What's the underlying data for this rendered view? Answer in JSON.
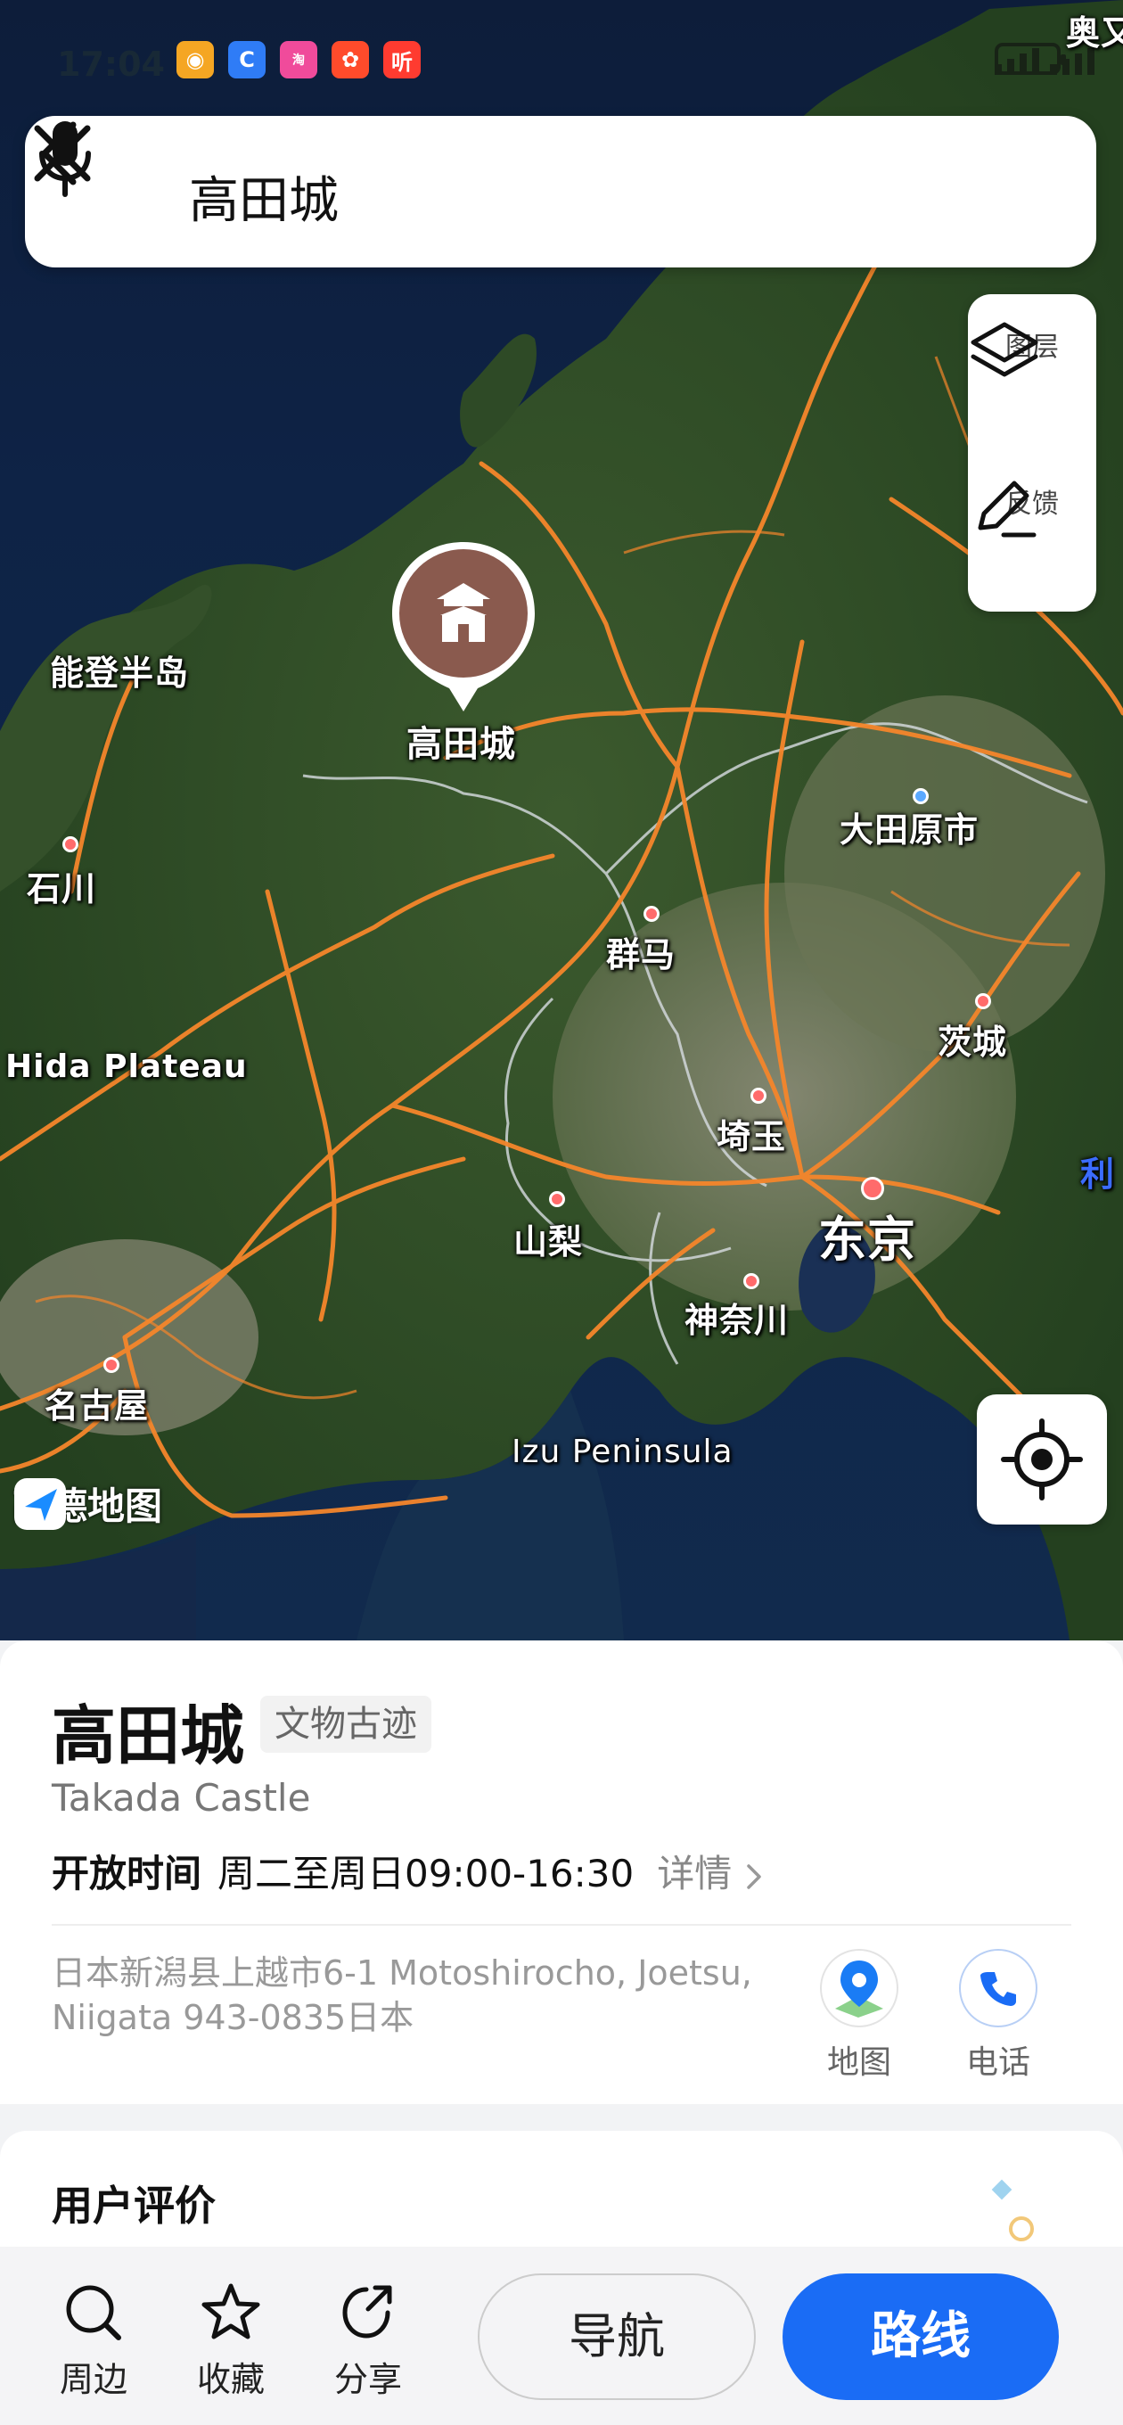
{
  "status_bar": {
    "time": "17:04",
    "apps": [
      {
        "icon": "weibo-icon",
        "text": "",
        "color": "#f5a623"
      },
      {
        "icon": "browser-360-icon",
        "text": "",
        "color": "#2f7cf6"
      },
      {
        "icon": "taobao-promo-icon",
        "text": "",
        "color": "#f04b9b"
      },
      {
        "icon": "pinduoduo-icon",
        "text": "",
        "color": "#ff4b2b"
      },
      {
        "icon": "ting-icon",
        "text": "听",
        "color": "#ff3b30"
      }
    ]
  },
  "search": {
    "query": "高田城"
  },
  "map_tools": {
    "layers_label": "图层",
    "feedback_label": "反馈"
  },
  "map": {
    "brand": "高德地图",
    "poi_label": "高田城",
    "labels": {
      "noto": "能登半岛",
      "ishikawa": "石川",
      "hida": "Hida Plateau",
      "nagoya": "名古屋",
      "gunma": "群马",
      "otawara": "大田原市",
      "ibaraki": "茨城",
      "saitama": "埼玉",
      "yamanashi": "山梨",
      "tokyo": "东京",
      "kanagawa": "神奈川",
      "izu": "Izu Peninsula",
      "edge_top": "奥又",
      "edge_right": "利"
    }
  },
  "poi": {
    "name": "高田城",
    "category": "文物古迹",
    "english_name": "Takada Castle",
    "hours_label": "开放时间",
    "hours": "周二至周日09:00-16:30",
    "details_label": "详情",
    "address": "日本新潟县上越市6-1 Motoshirocho, Joetsu, Niigata 943-0835日本",
    "map_button": "地图",
    "phone_button": "电话"
  },
  "reviews": {
    "title": "用户评价"
  },
  "bottom_bar": {
    "nearby": "周边",
    "favorite": "收藏",
    "share": "分享",
    "navigate": "导航",
    "route": "路线"
  },
  "colors": {
    "accent": "#1a6cf5",
    "road": "#f5862b",
    "poi_marker": "#8a5a4e"
  }
}
